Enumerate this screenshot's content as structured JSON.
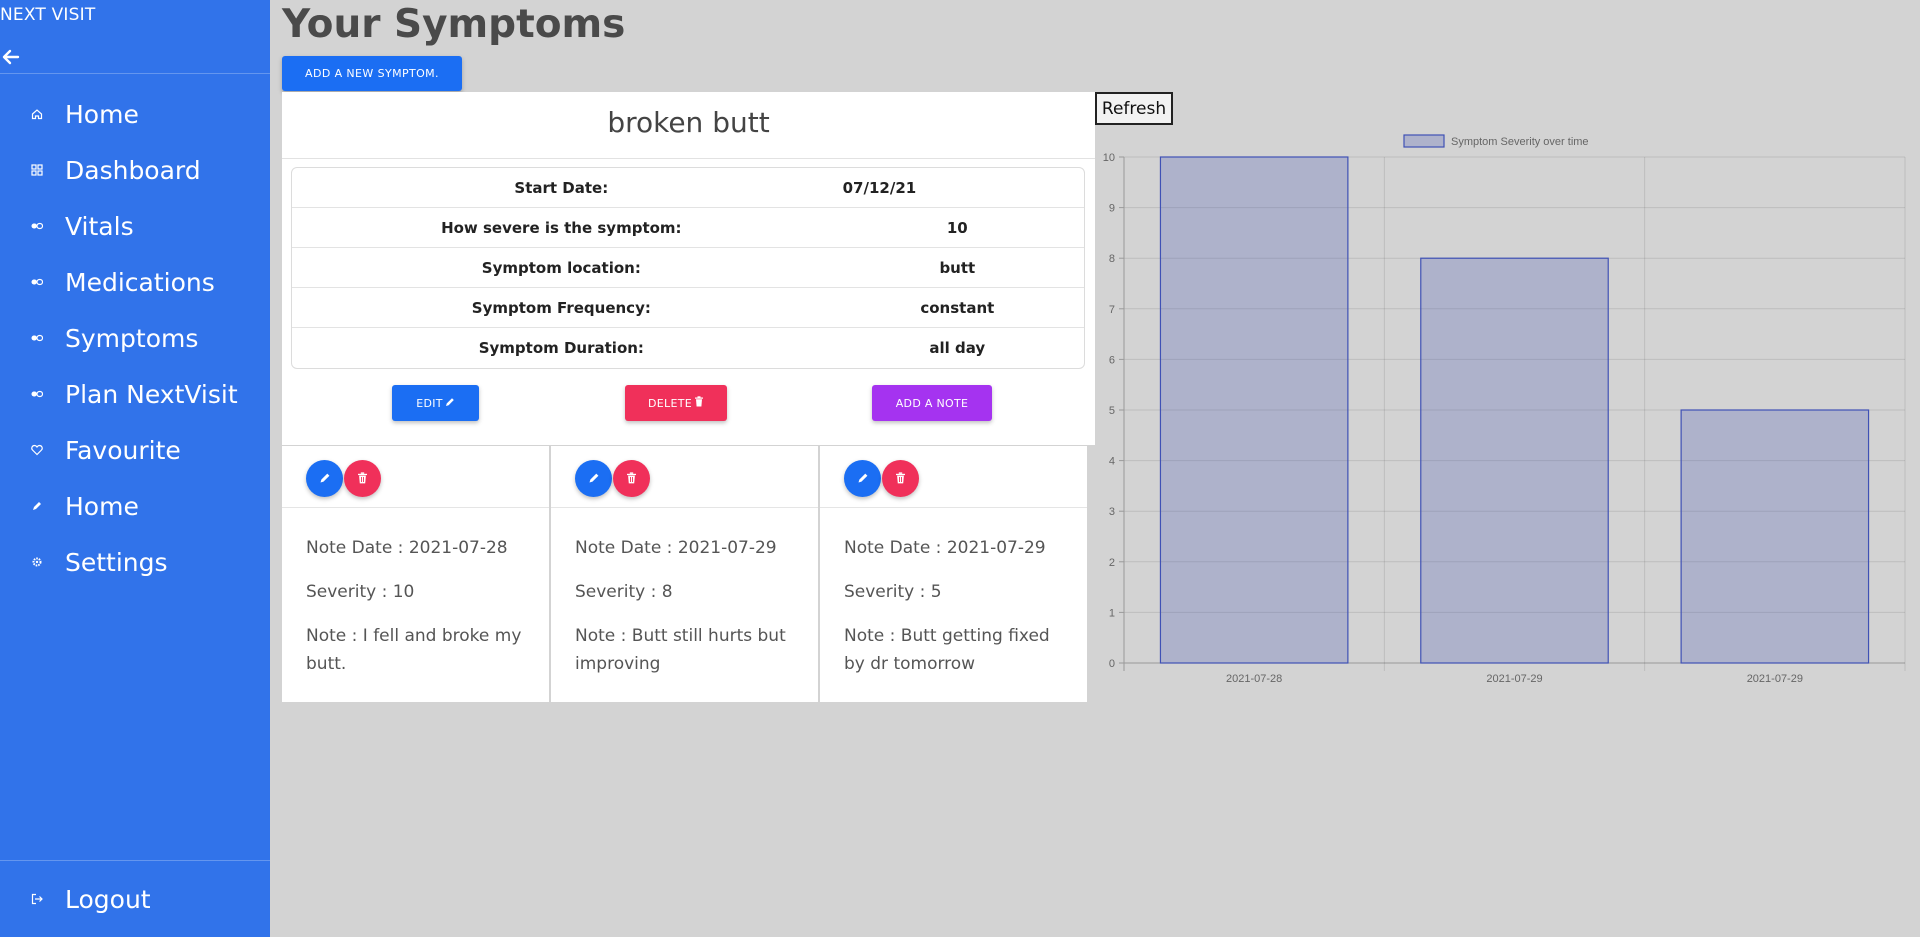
{
  "sidebar": {
    "brand": "NEXT VISIT",
    "items": [
      {
        "label": "Home",
        "icon": "home-icon"
      },
      {
        "label": "Dashboard",
        "icon": "dashboard-icon"
      },
      {
        "label": "Vitals",
        "icon": "pills-icon"
      },
      {
        "label": "Medications",
        "icon": "pills-icon"
      },
      {
        "label": "Symptoms",
        "icon": "pills-icon"
      },
      {
        "label": "Plan NextVisit",
        "icon": "pills-icon"
      },
      {
        "label": "Favourite",
        "icon": "heart-icon"
      },
      {
        "label": "Home",
        "icon": "pencil-icon"
      },
      {
        "label": "Settings",
        "icon": "gear-icon"
      }
    ],
    "logout_label": "Logout"
  },
  "main": {
    "title": "Your Symptoms",
    "add_symptom_label": "ADD A NEW SYMPTOM.",
    "refresh_label": "Refresh"
  },
  "symptom": {
    "name": "broken butt",
    "details": [
      {
        "label": "Start Date:",
        "value": "07/12/21"
      },
      {
        "label": "How severe is the symptom:",
        "value": "10"
      },
      {
        "label": "Symptom location:",
        "value": "butt"
      },
      {
        "label": "Symptom Frequency:",
        "value": "constant"
      },
      {
        "label": "Symptom Duration:",
        "value": "all day"
      }
    ],
    "edit_label": "EDIT",
    "delete_label": "DELETE",
    "add_note_label": "ADD A NOTE"
  },
  "notes": [
    {
      "date": "Note Date : 2021-07-28",
      "severity": "Severity : 10",
      "note": "Note : I fell and broke my butt."
    },
    {
      "date": "Note Date : 2021-07-29",
      "severity": "Severity : 8",
      "note": "Note : Butt still hurts but improving"
    },
    {
      "date": "Note Date : 2021-07-29",
      "severity": "Severity : 5",
      "note": "Note : Butt getting fixed by dr tomorrow"
    }
  ],
  "colors": {
    "sidebar": "#3173ea",
    "primary": "#1b6ef3",
    "danger": "#f0305a",
    "purple": "#a533f0",
    "bar_fill": "rgba(63,81,181,0.25)",
    "bar_stroke": "#3f51b5"
  },
  "chart_data": {
    "type": "bar",
    "categories": [
      "2021-07-28",
      "2021-07-29",
      "2021-07-29"
    ],
    "series": [
      {
        "name": "Symptom Severity over time",
        "values": [
          10,
          8,
          5
        ]
      }
    ],
    "ylim": [
      0,
      10
    ],
    "yticks": [
      0,
      1,
      2,
      3,
      4,
      5,
      6,
      7,
      8,
      9,
      10
    ],
    "grid": true,
    "legend": "top-center"
  }
}
